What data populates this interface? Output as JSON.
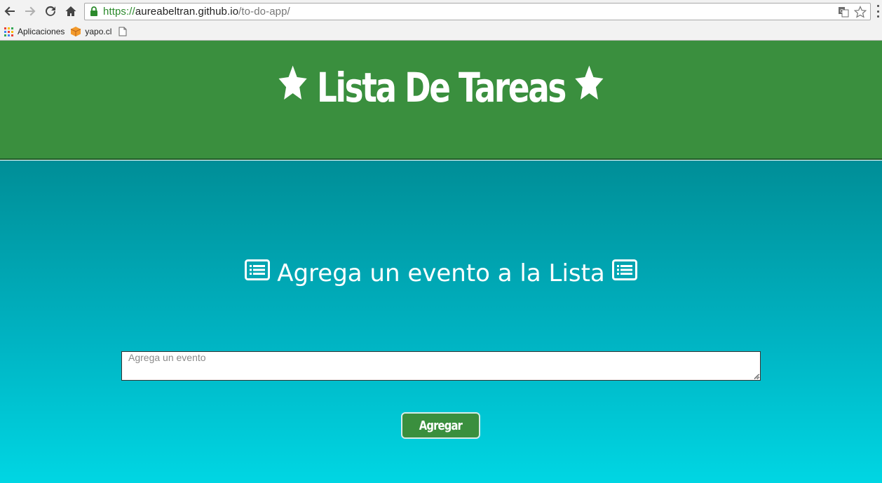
{
  "browser": {
    "url_scheme": "https://",
    "url_host": "aureabeltran.github.io",
    "url_path": "/to-do-app/",
    "bookmarks": [
      {
        "label": "Aplicaciones",
        "icon": "apps-grid-icon"
      },
      {
        "label": "yapo.cl",
        "icon": "yapo-box-icon"
      },
      {
        "label": "",
        "icon": "blank-page-icon"
      }
    ]
  },
  "page": {
    "title": "Lista De Tareas",
    "subtitle": "Agrega un evento a la Lista",
    "input": {
      "placeholder": "Agrega un evento",
      "value": ""
    },
    "add_button_label": "Agregar"
  },
  "colors": {
    "header_green": "#3a8f3e",
    "teal_top": "#008e97",
    "teal_bottom": "#00d6e3",
    "text_white": "#ffffff"
  }
}
